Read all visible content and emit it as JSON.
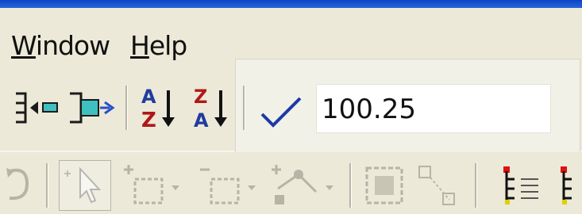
{
  "menu": {
    "window_label": "Window",
    "help_label": "Help"
  },
  "toolbar": {
    "value_field": "100.25"
  },
  "icons": {
    "move_left": "arrow-left-icon",
    "move_right": "arrow-right-icon",
    "sort_asc": "sort-a-z-icon",
    "sort_desc": "sort-z-a-icon",
    "accept": "checkmark-icon",
    "select": "pointer-icon",
    "add_rect": "add-rectangle-icon",
    "remove_rect": "remove-rectangle-icon",
    "add_node": "add-node-icon",
    "group": "group-icon",
    "ungroup": "ungroup-icon",
    "code1": "code-list-icon",
    "code2": "code-icon"
  },
  "colors": {
    "title_blue": "#0a46c8",
    "check_blue": "#1c3aa8",
    "sort_blue": "#1f3c9e",
    "sort_red": "#b01818"
  }
}
